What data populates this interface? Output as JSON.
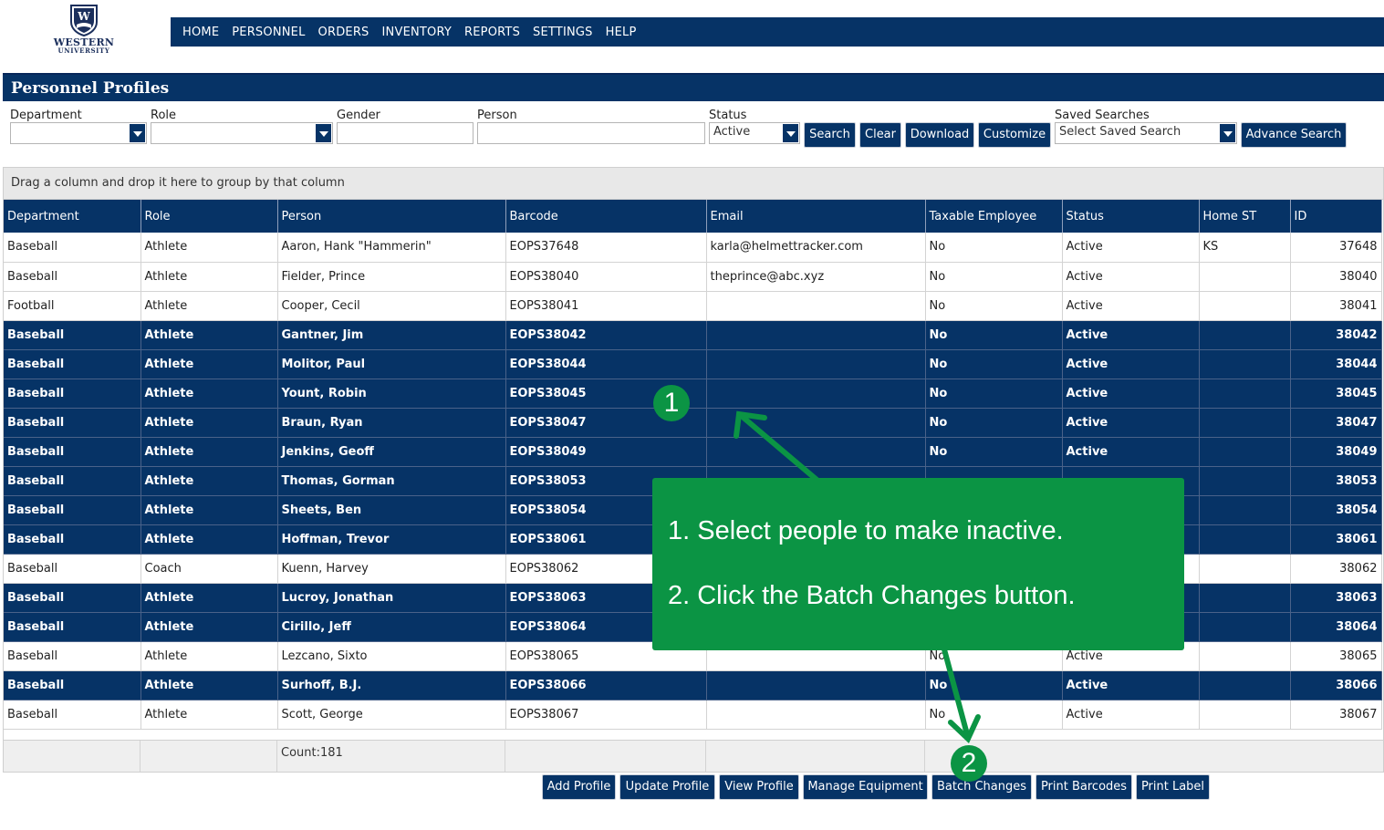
{
  "logo": {
    "line1": "WESTERN",
    "line2": "UNIVERSITY"
  },
  "nav": [
    "HOME",
    "PERSONNEL",
    "ORDERS",
    "INVENTORY",
    "REPORTS",
    "SETTINGS",
    "HELP"
  ],
  "page_title": "Personnel Profiles",
  "filters": {
    "department_label": "Department",
    "role_label": "Role",
    "gender_label": "Gender",
    "person_label": "Person",
    "status_label": "Status",
    "status_value": "Active",
    "saved_label": "Saved Searches",
    "saved_value": "Select Saved Search"
  },
  "filter_buttons": {
    "search": "Search",
    "clear": "Clear",
    "download": "Download",
    "customize": "Customize",
    "advance": "Advance Search"
  },
  "grid": {
    "group_hint": "Drag a column and drop it here to group by that column",
    "columns": [
      "Department",
      "Role",
      "Person",
      "Barcode",
      "Email",
      "Taxable Employee",
      "Status",
      "Home ST",
      "ID"
    ],
    "rows": [
      {
        "dept": "Baseball",
        "role": "Athlete",
        "person": "Aaron, Hank \"Hammerin\"",
        "barcode": "EOPS37648",
        "email": "karla@helmettracker.com",
        "tax": "No",
        "status": "Active",
        "st": "KS",
        "id": "37648",
        "selected": false
      },
      {
        "dept": "Baseball",
        "role": "Athlete",
        "person": "Fielder, Prince",
        "barcode": "EOPS38040",
        "email": "theprince@abc.xyz",
        "tax": "No",
        "status": "Active",
        "st": "",
        "id": "38040",
        "selected": false
      },
      {
        "dept": "Football",
        "role": "Athlete",
        "person": "Cooper, Cecil",
        "barcode": "EOPS38041",
        "email": "",
        "tax": "No",
        "status": "Active",
        "st": "",
        "id": "38041",
        "selected": false
      },
      {
        "dept": "Baseball",
        "role": "Athlete",
        "person": "Gantner, Jim",
        "barcode": "EOPS38042",
        "email": "",
        "tax": "No",
        "status": "Active",
        "st": "",
        "id": "38042",
        "selected": true
      },
      {
        "dept": "Baseball",
        "role": "Athlete",
        "person": "Molitor, Paul",
        "barcode": "EOPS38044",
        "email": "",
        "tax": "No",
        "status": "Active",
        "st": "",
        "id": "38044",
        "selected": true
      },
      {
        "dept": "Baseball",
        "role": "Athlete",
        "person": "Yount, Robin",
        "barcode": "EOPS38045",
        "email": "",
        "tax": "No",
        "status": "Active",
        "st": "",
        "id": "38045",
        "selected": true
      },
      {
        "dept": "Baseball",
        "role": "Athlete",
        "person": "Braun, Ryan",
        "barcode": "EOPS38047",
        "email": "",
        "tax": "No",
        "status": "Active",
        "st": "",
        "id": "38047",
        "selected": true
      },
      {
        "dept": "Baseball",
        "role": "Athlete",
        "person": "Jenkins, Geoff",
        "barcode": "EOPS38049",
        "email": "",
        "tax": "No",
        "status": "Active",
        "st": "",
        "id": "38049",
        "selected": true
      },
      {
        "dept": "Baseball",
        "role": "Athlete",
        "person": "Thomas, Gorman",
        "barcode": "EOPS38053",
        "email": "",
        "tax": "",
        "status": "",
        "st": "",
        "id": "38053",
        "selected": true
      },
      {
        "dept": "Baseball",
        "role": "Athlete",
        "person": "Sheets, Ben",
        "barcode": "EOPS38054",
        "email": "",
        "tax": "",
        "status": "",
        "st": "",
        "id": "38054",
        "selected": true
      },
      {
        "dept": "Baseball",
        "role": "Athlete",
        "person": "Hoffman, Trevor",
        "barcode": "EOPS38061",
        "email": "",
        "tax": "",
        "status": "",
        "st": "",
        "id": "38061",
        "selected": true
      },
      {
        "dept": "Baseball",
        "role": "Coach",
        "person": "Kuenn, Harvey",
        "barcode": "EOPS38062",
        "email": "",
        "tax": "",
        "status": "",
        "st": "",
        "id": "38062",
        "selected": false
      },
      {
        "dept": "Baseball",
        "role": "Athlete",
        "person": "Lucroy, Jonathan",
        "barcode": "EOPS38063",
        "email": "",
        "tax": "",
        "status": "",
        "st": "",
        "id": "38063",
        "selected": true
      },
      {
        "dept": "Baseball",
        "role": "Athlete",
        "person": "Cirillo, Jeff",
        "barcode": "EOPS38064",
        "email": "",
        "tax": "",
        "status": "",
        "st": "",
        "id": "38064",
        "selected": true
      },
      {
        "dept": "Baseball",
        "role": "Athlete",
        "person": "Lezcano, Sixto",
        "barcode": "EOPS38065",
        "email": "",
        "tax": "No",
        "status": "Active",
        "st": "",
        "id": "38065",
        "selected": false
      },
      {
        "dept": "Baseball",
        "role": "Athlete",
        "person": "Surhoff, B.J.",
        "barcode": "EOPS38066",
        "email": "",
        "tax": "No",
        "status": "Active",
        "st": "",
        "id": "38066",
        "selected": true
      },
      {
        "dept": "Baseball",
        "role": "Athlete",
        "person": "Scott, George",
        "barcode": "EOPS38067",
        "email": "",
        "tax": "No",
        "status": "Active",
        "st": "",
        "id": "38067",
        "selected": false
      }
    ],
    "count_text": "Count:181"
  },
  "bottom_buttons": [
    "Add Profile",
    "Update Profile",
    "View Profile",
    "Manage Equipment",
    "Batch Changes",
    "Print Barcodes",
    "Print Label"
  ],
  "callout": {
    "step1": "1. Select people to make inactive.",
    "step2": "2. Click the Batch Changes button.",
    "badge1": "1",
    "badge2": "2"
  },
  "colors": {
    "navy": "#063366",
    "green": "#0b9444"
  }
}
